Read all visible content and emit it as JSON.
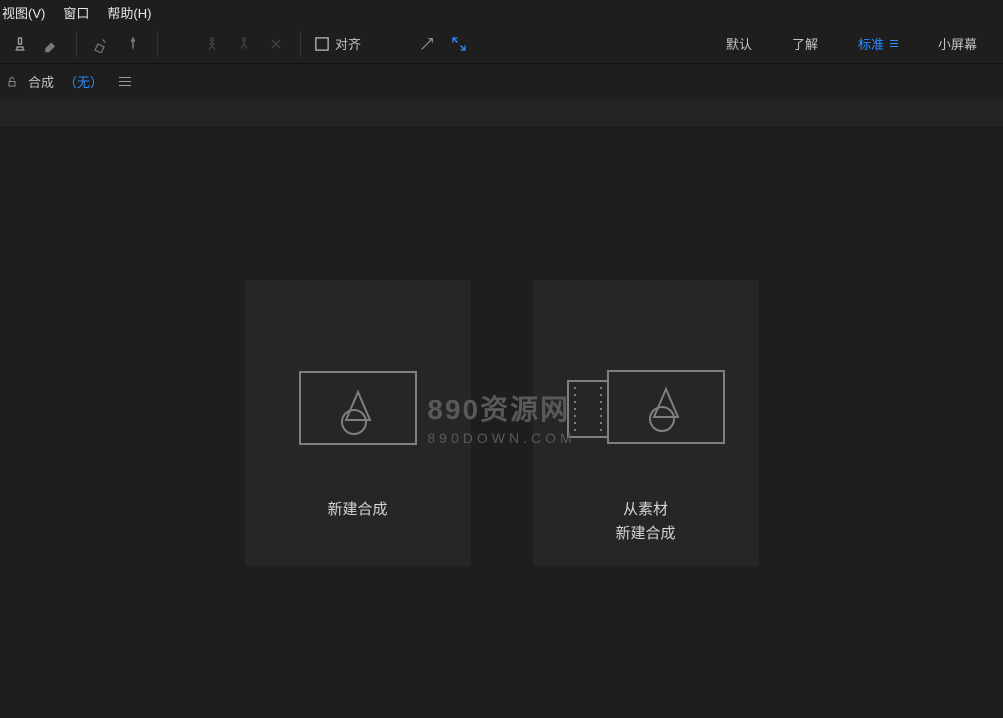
{
  "menu": {
    "view": "视图(V)",
    "window": "窗口",
    "help": "帮助(H)"
  },
  "toolbar": {
    "align": "对齐"
  },
  "workspaces": {
    "default": "默认",
    "learn": "了解",
    "standard": "标准",
    "small": "小屏幕"
  },
  "comp_panel": {
    "label": "合成",
    "none": "（无）"
  },
  "cards": {
    "new_comp": "新建合成",
    "from_footage_line1": "从素材",
    "from_footage_line2": "新建合成"
  },
  "watermark": {
    "line1": "890资源网",
    "line2": "890DOWN.COM"
  }
}
